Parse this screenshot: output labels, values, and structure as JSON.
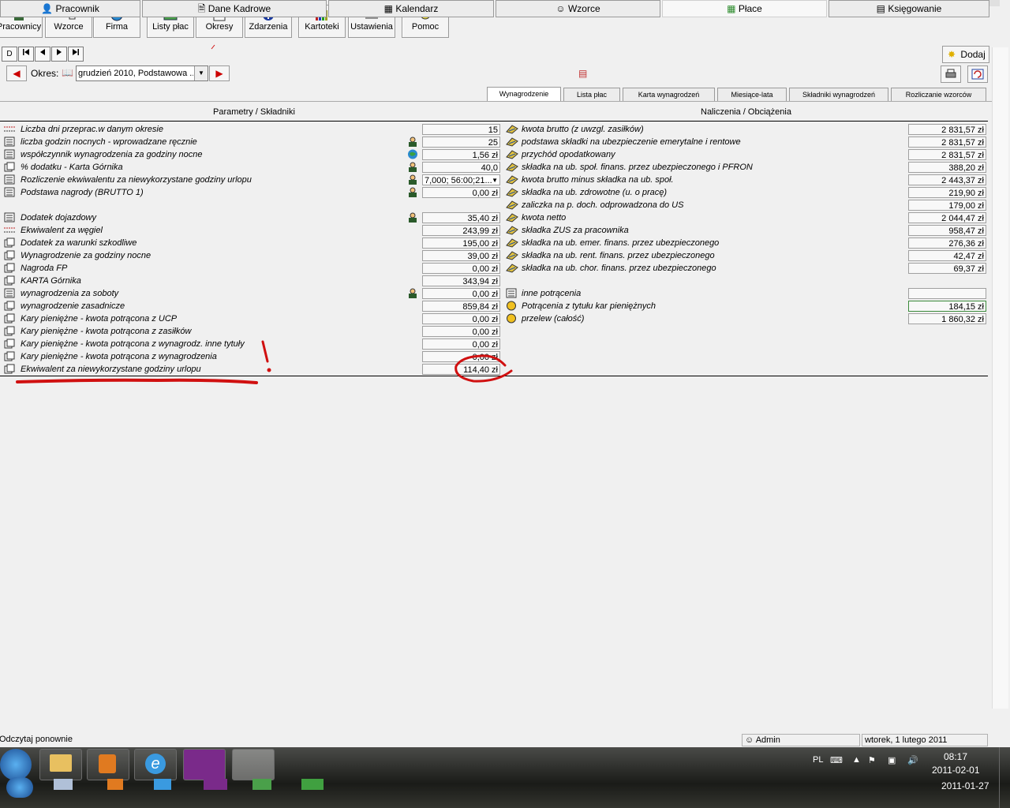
{
  "toolbar": {
    "buttons": [
      {
        "label": "Pracownicy"
      },
      {
        "label": "Wzorce"
      },
      {
        "label": "Firma"
      },
      {
        "label": "Listy płac"
      },
      {
        "label": "Okresy"
      },
      {
        "label": "Zdarzenia"
      },
      {
        "label": "Kartoteki"
      },
      {
        "label": "Ustawienia"
      },
      {
        "label": "Pomoc"
      }
    ]
  },
  "nav": {
    "first_label": "D",
    "okres_label": "Okres:",
    "okres_value": "grudzień 2010, Podstawowa ...",
    "dodaj_label": "Dodaj"
  },
  "tabs": [
    "Wynagrodzenie",
    "Lista płac",
    "Karta wynagrodzeń",
    "Miesiące-lata",
    "Składniki wynagrodzeń",
    "Rozliczanie wzorców"
  ],
  "headers": {
    "left": "Parametry / Składniki",
    "right": "Naliczenia / Obciążenia"
  },
  "left_rows": [
    {
      "label": "Liczba dni przeprac.w danym okresie",
      "value": "15",
      "person": false
    },
    {
      "label": "liczba godzin nocnych - wprowadzane ręcznie",
      "value": "25",
      "person": true
    },
    {
      "label": "współczynnik wynagrodzenia za godziny nocne",
      "value": "1,56 zł",
      "person": "globe"
    },
    {
      "label": "% dodatku - Karta Górnika",
      "value": "40,0",
      "person": true
    },
    {
      "label": "Rozliczenie ekwiwalentu za niewykorzystane godziny urlopu",
      "value": "7,000; 56:00;21...",
      "person": true,
      "dropdown": true
    },
    {
      "label": "Podstawa nagrody (BRUTTO 1)",
      "value": "0,00 zł",
      "person": true
    },
    {
      "label": "",
      "value": "",
      "person": false,
      "spacer": true
    },
    {
      "label": "Dodatek dojazdowy",
      "value": "35,40 zł",
      "person": true
    },
    {
      "label": "Ekwiwalent za węgiel",
      "value": "243,99 zł",
      "person": false
    },
    {
      "label": "Dodatek za warunki szkodliwe",
      "value": "195,00 zł",
      "person": false
    },
    {
      "label": "Wynagrodzenie za godziny nocne",
      "value": "39,00 zł",
      "person": false
    },
    {
      "label": "Nagroda FP",
      "value": "0,00 zł",
      "person": false
    },
    {
      "label": "KARTA Górnika",
      "value": "343,94 zł",
      "person": false
    },
    {
      "label": "wynagrodzenia za soboty",
      "value": "0,00 zł",
      "person": true
    },
    {
      "label": "wynagrodzenie zasadnicze",
      "value": "859,84 zł",
      "person": false
    },
    {
      "label": "Kary pieniężne - kwota potrącona z UCP",
      "value": "0,00 zł",
      "person": false
    },
    {
      "label": "Kary pieniężne - kwota potrącona z zasiłków",
      "value": "0,00 zł",
      "person": false
    },
    {
      "label": "Kary pieniężne - kwota potrącona z wynagrodz. inne tytuły",
      "value": "0,00 zł",
      "person": false
    },
    {
      "label": "Kary pieniężne - kwota potrącona z wynagrodzenia",
      "value": "0,00 zł",
      "person": false
    },
    {
      "label": "Ekwiwalent za niewykorzystane godziny urlopu",
      "value": "114,40 zł",
      "person": false
    }
  ],
  "right_rows": [
    {
      "label": "kwota brutto (z uwzgl. zasiłków)",
      "value": "2 831,57 zł"
    },
    {
      "label": "podstawa składki na ubezpieczenie emerytalne i rentowe",
      "value": "2 831,57 zł"
    },
    {
      "label": "przychód opodatkowany",
      "value": "2 831,57 zł"
    },
    {
      "label": "składka na ub. społ. finans. przez ubezpieczonego i PFRON",
      "value": "388,20 zł"
    },
    {
      "label": "kwota brutto minus składka na ub. społ.",
      "value": "2 443,37 zł"
    },
    {
      "label": "składka na ub. zdrowotne (u. o pracę)",
      "value": "219,90 zł"
    },
    {
      "label": "zaliczka na p. doch. odprowadzona do US",
      "value": "179,00 zł"
    },
    {
      "label": "kwota netto",
      "value": "2 044,47 zł"
    },
    {
      "label": "składka ZUS za pracownika",
      "value": "958,47 zł"
    },
    {
      "label": "składka na ub. emer. finans. przez ubezpieczonego",
      "value": "276,36 zł"
    },
    {
      "label": "składka na ub. rent. finans. przez ubezpieczonego",
      "value": "42,47 zł"
    },
    {
      "label": "składka na ub. chor. finans. przez ubezpieczonego",
      "value": "69,37 zł"
    },
    {
      "label": "",
      "value": "",
      "spacer": true
    },
    {
      "label": "inne potrącenia",
      "value": ""
    },
    {
      "label": "Potrącenia z tytułu kar pieniężnych",
      "value": "184,15 zł"
    },
    {
      "label": "przelew (całość)",
      "value": "1 860,32 zł"
    }
  ],
  "bottom_tabs": [
    "Pracownik",
    "Dane Kadrowe",
    "Kalendarz",
    "Wzorce",
    "Płace",
    "Księgowanie"
  ],
  "status": {
    "left": "Odczytaj ponownie",
    "user": "Admin",
    "date": "wtorek, 1 lutego 2011"
  },
  "tray": {
    "lang": "PL",
    "time": "08:17",
    "date1": "2011-02-01",
    "date2": "2011-01-27"
  }
}
